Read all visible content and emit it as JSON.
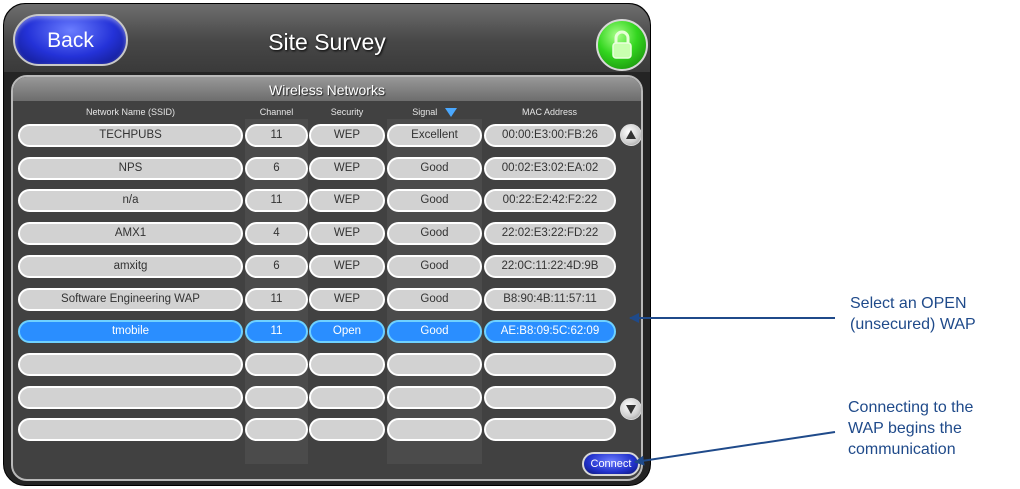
{
  "header": {
    "title": "Site Survey",
    "back_label": "Back"
  },
  "panel": {
    "title": "Wireless Networks"
  },
  "columns": [
    "Network Name (SSID)",
    "Channel",
    "Security",
    "Signal",
    "MAC Address"
  ],
  "rows": [
    {
      "ssid": "TECHPUBS",
      "channel": "11",
      "security": "WEP",
      "signal": "Excellent",
      "mac": "00:00:E3:00:FB:26"
    },
    {
      "ssid": "NPS",
      "channel": "6",
      "security": "WEP",
      "signal": "Good",
      "mac": "00:02:E3:02:EA:02"
    },
    {
      "ssid": "n/a",
      "channel": "11",
      "security": "WEP",
      "signal": "Good",
      "mac": "00:22:E2:42:F2:22"
    },
    {
      "ssid": "AMX1",
      "channel": "4",
      "security": "WEP",
      "signal": "Good",
      "mac": "22:02:E3:22:FD:22"
    },
    {
      "ssid": "amxitg",
      "channel": "6",
      "security": "WEP",
      "signal": "Good",
      "mac": "22:0C:11:22:4D:9B"
    },
    {
      "ssid": "Software Engineering WAP",
      "channel": "11",
      "security": "WEP",
      "signal": "Good",
      "mac": "B8:90:4B:11:57:11"
    },
    {
      "ssid": "tmobile",
      "channel": "11",
      "security": "Open",
      "signal": "Good",
      "mac": "AE:B8:09:5C:62:09",
      "selected": true
    },
    {
      "ssid": "",
      "channel": "",
      "security": "",
      "signal": "",
      "mac": ""
    },
    {
      "ssid": "",
      "channel": "",
      "security": "",
      "signal": "",
      "mac": ""
    },
    {
      "ssid": "",
      "channel": "",
      "security": "",
      "signal": "",
      "mac": ""
    }
  ],
  "connect_label": "Connect",
  "annotations": {
    "select_open": [
      "Select an OPEN",
      "(unsecured) WAP"
    ],
    "connecting": [
      "Connecting to the",
      "WAP begins the",
      "communication"
    ]
  },
  "colors": {
    "selected_row": "#2a8eff",
    "accent_blue": "#1f4a8a",
    "lock_green": "#33d61f",
    "back_blue": "#2432d8"
  },
  "icons": {
    "lock": "lock-icon",
    "sort": "sort-arrow-down-icon",
    "scroll_up": "scroll-up-icon",
    "scroll_down": "scroll-down-icon"
  }
}
